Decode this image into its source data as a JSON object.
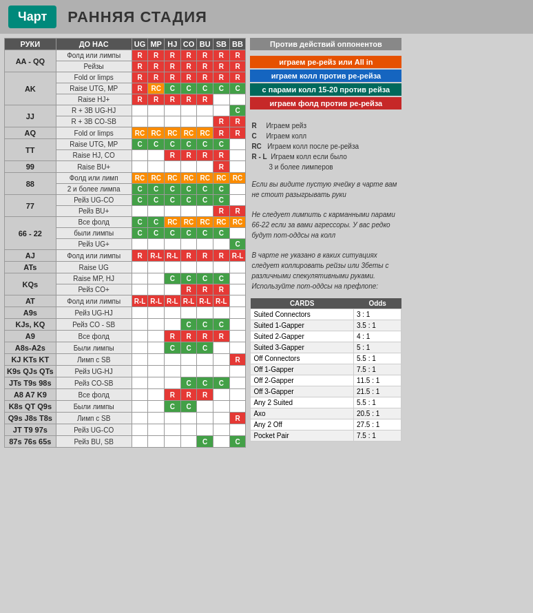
{
  "header": {
    "logo": "Чарт",
    "title": "РАННЯЯ СТАДИЯ"
  },
  "columns": [
    "РУКИ",
    "ДО НАС",
    "UG",
    "MP",
    "HJ",
    "CO",
    "BU",
    "SB",
    "BB"
  ],
  "legend": {
    "title": "Против действий оппонентов",
    "items": [
      {
        "text": "играем ре-рейз или All in",
        "class": "legend-orange"
      },
      {
        "text": "играем колл против ре-рейза",
        "class": "legend-blue"
      },
      {
        "text": "с парами колл 15-20 против рейза",
        "class": "legend-teal"
      },
      {
        "text": "играем фолд против ре-рейза",
        "class": "legend-red"
      }
    ]
  },
  "legend_abbr": [
    {
      "key": "R",
      "val": "Играем рейз"
    },
    {
      "key": "C",
      "val": "Играем колл"
    },
    {
      "key": "RC",
      "val": "Играем колл после ре-рейза"
    },
    {
      "key": "R - L",
      "val": "Играем колл если было 3 и более лимперов"
    }
  ],
  "note1": "Если вы видите пустую ячейку в чарте вам не стоит разыгрывать руки",
  "note2": "Не следует лимпить с карманными парами 66-22 если за вами агрессоры. У вас редко будут пот-оддсы на колл",
  "note3": "В чарте не указано в каких ситуациях следует коллировать рейзы или 3беты с различными спекулятивными руками. Используйте пот-оддсы на префлопе:",
  "cards_table": {
    "headers": [
      "CARDS",
      "Odds"
    ],
    "rows": [
      [
        "Suited Connectors",
        "3 : 1"
      ],
      [
        "Suited 1-Gapper",
        "3.5 : 1"
      ],
      [
        "Suited 2-Gapper",
        "4 : 1"
      ],
      [
        "Suited 3-Gapper",
        "5 : 1"
      ],
      [
        "Off Connectors",
        "5.5 : 1"
      ],
      [
        "Off 1-Gapper",
        "7.5 : 1"
      ],
      [
        "Off 2-Gapper",
        "11.5 : 1"
      ],
      [
        "Off 3-Gapper",
        "21.5 : 1"
      ],
      [
        "Any 2 Suited",
        "5.5 : 1"
      ],
      [
        "Axo",
        "20.5 : 1"
      ],
      [
        "Any 2 Off",
        "27.5 : 1"
      ],
      [
        "Pocket Pair",
        "7.5 : 1"
      ]
    ]
  },
  "rows": [
    {
      "hand": "AA - QQ",
      "actions": [
        {
          "desc": "Фолд или лимпы",
          "cells": [
            "R",
            "R",
            "R",
            "R",
            "R",
            "R",
            "R"
          ]
        },
        {
          "desc": "Рейзы",
          "cells": [
            "R",
            "R",
            "R",
            "R",
            "R",
            "R",
            "R"
          ]
        }
      ]
    },
    {
      "hand": "AK",
      "actions": [
        {
          "desc": "Fold or limps",
          "cells": [
            "R",
            "R",
            "R",
            "R",
            "R",
            "R",
            "R"
          ]
        },
        {
          "desc": "Raise UTG, MP",
          "cells": [
            "R",
            "RC",
            "C",
            "C",
            "C",
            "C",
            "C"
          ]
        },
        {
          "desc": "Raise HJ+",
          "cells": [
            "R",
            "R",
            "R",
            "R",
            "R",
            "",
            ""
          ]
        }
      ]
    },
    {
      "hand": "JJ",
      "actions": [
        {
          "desc": "R + 3B UG-HJ",
          "cells": [
            "",
            "",
            "",
            "",
            "",
            "",
            "C"
          ]
        },
        {
          "desc": "R + 3B CO-SB",
          "cells": [
            "",
            "",
            "",
            "",
            "",
            "R",
            "R"
          ]
        }
      ]
    },
    {
      "hand": "AQ",
      "actions": [
        {
          "desc": "Fold or limps",
          "cells": [
            "RC",
            "RC",
            "RC",
            "RC",
            "RC",
            "R",
            "R"
          ]
        }
      ]
    },
    {
      "hand": "TT",
      "actions": [
        {
          "desc": "Raise UTG, MP",
          "cells": [
            "C",
            "C",
            "C",
            "C",
            "C",
            "C",
            ""
          ]
        },
        {
          "desc": "Raise HJ, CO",
          "cells": [
            "",
            "",
            "R",
            "R",
            "R",
            "R",
            ""
          ]
        }
      ]
    },
    {
      "hand": "99",
      "actions": [
        {
          "desc": "Raise BU+",
          "cells": [
            "",
            "",
            "",
            "",
            "",
            "R",
            ""
          ]
        }
      ]
    },
    {
      "hand": "88",
      "actions": [
        {
          "desc": "Фолд или лимп",
          "cells": [
            "RC",
            "RC",
            "RC",
            "RC",
            "RC",
            "RC",
            "RC"
          ]
        },
        {
          "desc": "2 и более лимпа",
          "cells": [
            "C",
            "C",
            "C",
            "C",
            "C",
            "C",
            ""
          ]
        }
      ]
    },
    {
      "hand": "77",
      "actions": [
        {
          "desc": "Рейз UG-CO",
          "cells": [
            "C",
            "C",
            "C",
            "C",
            "C",
            "C",
            ""
          ]
        },
        {
          "desc": "Рейз BU+",
          "cells": [
            "",
            "",
            "",
            "",
            "",
            "R",
            "R"
          ]
        }
      ]
    },
    {
      "hand": "66 - 22",
      "actions": [
        {
          "desc": "Все фолд",
          "cells": [
            "C",
            "C",
            "RC",
            "RC",
            "RC",
            "RC",
            "RC"
          ]
        },
        {
          "desc": "были лимпы",
          "cells": [
            "C",
            "C",
            "C",
            "C",
            "C",
            "C",
            ""
          ]
        },
        {
          "desc": "Рейз UG+",
          "cells": [
            "",
            "",
            "",
            "",
            "",
            "",
            "C"
          ]
        }
      ]
    },
    {
      "hand": "AJ",
      "actions": [
        {
          "desc": "Фолд или лимпы",
          "cells": [
            "R",
            "R-L",
            "R-L",
            "R",
            "R",
            "R",
            "R-L"
          ]
        }
      ]
    },
    {
      "hand": "ATs",
      "actions": [
        {
          "desc": "Raise UG",
          "cells": [
            "",
            "",
            "",
            "",
            "",
            "",
            ""
          ]
        }
      ]
    },
    {
      "hand": "KQs",
      "actions": [
        {
          "desc": "Raise MP, HJ",
          "cells": [
            "",
            "",
            "C",
            "C",
            "C",
            "C",
            ""
          ]
        },
        {
          "desc": "Рейз CO+",
          "cells": [
            "",
            "",
            "",
            "R",
            "R",
            "R",
            ""
          ]
        }
      ]
    },
    {
      "hand": "AT",
      "actions": [
        {
          "desc": "Фолд или лимпы",
          "cells": [
            "R-L",
            "R-L",
            "R-L",
            "R-L",
            "R-L",
            "R-L",
            ""
          ]
        }
      ]
    },
    {
      "hand": "A9s",
      "actions": [
        {
          "desc": "Рейз UG-HJ",
          "cells": [
            "",
            "",
            "",
            "",
            "",
            "",
            ""
          ]
        }
      ]
    },
    {
      "hand": "KJs, KQ",
      "actions": [
        {
          "desc": "Рейз CO - SB",
          "cells": [
            "",
            "",
            "",
            "C",
            "C",
            "C",
            ""
          ]
        }
      ]
    },
    {
      "hand": "A9",
      "actions": [
        {
          "desc": "Все фолд",
          "cells": [
            "",
            "",
            "R",
            "R",
            "R",
            "R",
            ""
          ]
        }
      ]
    },
    {
      "hand": "A8s-A2s",
      "actions": [
        {
          "desc": "Были лимпы",
          "cells": [
            "",
            "",
            "C",
            "C",
            "C",
            "",
            ""
          ]
        }
      ]
    },
    {
      "hand": "KJ  KTs  KT",
      "actions": [
        {
          "desc": "Лимп с SB",
          "cells": [
            "",
            "",
            "",
            "",
            "",
            "",
            "R"
          ]
        }
      ]
    },
    {
      "hand": "K9s QJs QTs",
      "actions": [
        {
          "desc": "Рейз UG-HJ",
          "cells": [
            "",
            "",
            "",
            "",
            "",
            "",
            ""
          ]
        }
      ]
    },
    {
      "hand": "JTs  T9s  98s",
      "actions": [
        {
          "desc": "Рейз CO-SB",
          "cells": [
            "",
            "",
            "",
            "C",
            "C",
            "C",
            ""
          ]
        }
      ]
    },
    {
      "hand": "A8  A7  K9",
      "actions": [
        {
          "desc": "Все фолд",
          "cells": [
            "",
            "",
            "R",
            "R",
            "R",
            "",
            ""
          ]
        }
      ]
    },
    {
      "hand": "K8s  QT  Q9s",
      "actions": [
        {
          "desc": "Были лимпы",
          "cells": [
            "",
            "",
            "C",
            "C",
            "",
            "",
            ""
          ]
        }
      ]
    },
    {
      "hand": "Q9s  J8s  T8s",
      "actions": [
        {
          "desc": "Лимп с SB",
          "cells": [
            "",
            "",
            "",
            "",
            "",
            "",
            "R"
          ]
        }
      ]
    },
    {
      "hand": "JT  T9  97s",
      "actions": [
        {
          "desc": "Рейз UG-CO",
          "cells": [
            "",
            "",
            "",
            "",
            "",
            "",
            ""
          ]
        }
      ]
    },
    {
      "hand": "87s  76s  65s",
      "actions": [
        {
          "desc": "Рейз BU, SB",
          "cells": [
            "",
            "",
            "",
            "",
            "C",
            "",
            "C"
          ]
        }
      ]
    }
  ]
}
